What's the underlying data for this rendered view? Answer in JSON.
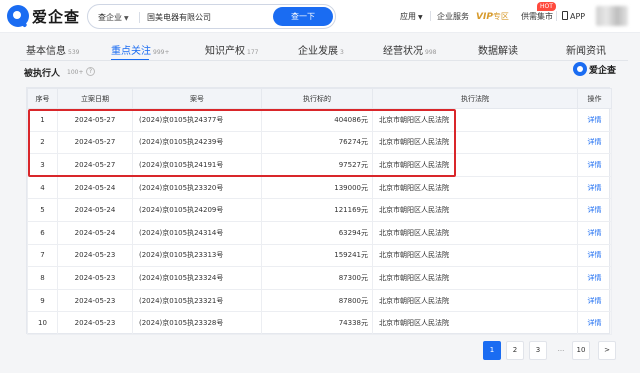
{
  "logo": {
    "text": "爱企查"
  },
  "search": {
    "scope": "查企业",
    "value": "国美电器有限公司",
    "button": "查一下"
  },
  "nav": {
    "apps": "应用",
    "service": "企业服务",
    "vip_bold": "VIP",
    "vip_rest": "专区",
    "market": "供需集市",
    "hot": "HOT",
    "app": "APP"
  },
  "tabs": [
    {
      "label": "基本信息",
      "count": "539"
    },
    {
      "label": "重点关注",
      "count": "999+"
    },
    {
      "label": "知识产权",
      "count": "177"
    },
    {
      "label": "企业发展",
      "count": "3"
    },
    {
      "label": "经营状况",
      "count": "998"
    },
    {
      "label": "数据解读",
      "count": ""
    },
    {
      "label": "新闻资讯",
      "count": ""
    }
  ],
  "section": {
    "title": "被执行人",
    "count": "100+",
    "help": "?",
    "watermark": "爱企查"
  },
  "table": {
    "headers": [
      "序号",
      "立案日期",
      "案号",
      "执行标的",
      "执行法院",
      "操作"
    ],
    "rows": [
      [
        "1",
        "2024-05-27",
        "(2024)京0105执24377号",
        "404086元",
        "北京市朝阳区人民法院",
        "详情"
      ],
      [
        "2",
        "2024-05-27",
        "(2024)京0105执24239号",
        "76274元",
        "北京市朝阳区人民法院",
        "详情"
      ],
      [
        "3",
        "2024-05-27",
        "(2024)京0105执24191号",
        "97527元",
        "北京市朝阳区人民法院",
        "详情"
      ],
      [
        "4",
        "2024-05-24",
        "(2024)京0105执23320号",
        "139000元",
        "北京市朝阳区人民法院",
        "详情"
      ],
      [
        "5",
        "2024-05-24",
        "(2024)京0105执24209号",
        "121169元",
        "北京市朝阳区人民法院",
        "详情"
      ],
      [
        "6",
        "2024-05-24",
        "(2024)京0105执24314号",
        "63294元",
        "北京市朝阳区人民法院",
        "详情"
      ],
      [
        "7",
        "2024-05-23",
        "(2024)京0105执23313号",
        "159241元",
        "北京市朝阳区人民法院",
        "详情"
      ],
      [
        "8",
        "2024-05-23",
        "(2024)京0105执23324号",
        "87300元",
        "北京市朝阳区人民法院",
        "详情"
      ],
      [
        "9",
        "2024-05-23",
        "(2024)京0105执23321号",
        "87800元",
        "北京市朝阳区人民法院",
        "详情"
      ],
      [
        "10",
        "2024-05-23",
        "(2024)京0105执23328号",
        "74338元",
        "北京市朝阳区人民法院",
        "详情"
      ]
    ]
  },
  "pagination": {
    "pages": [
      "1",
      "2",
      "3",
      "...",
      "10"
    ],
    "next": ">",
    "current": "1"
  },
  "colors": {
    "accent": "#1a6cf2",
    "highlight": "#d9262a",
    "vip": "#d79a2b",
    "hot": "#ff4a3d"
  }
}
